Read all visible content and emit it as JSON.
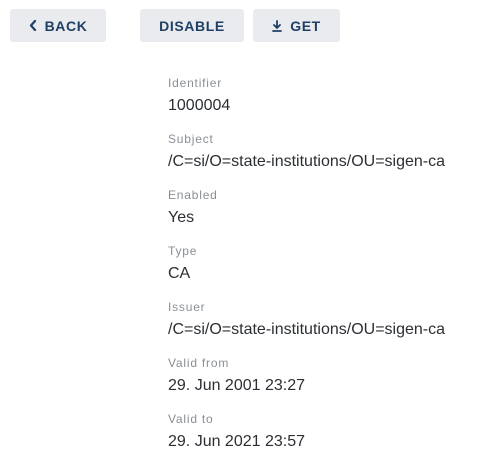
{
  "toolbar": {
    "back_label": "BACK",
    "back_icon": "chevron-left-icon",
    "disable_label": "DISABLE",
    "get_label": "GET",
    "get_icon": "download-icon"
  },
  "details": {
    "identifier": {
      "label": "Identifier",
      "value": "1000004"
    },
    "subject": {
      "label": "Subject",
      "value": "/C=si/O=state-institutions/OU=sigen-ca"
    },
    "enabled": {
      "label": "Enabled",
      "value": "Yes"
    },
    "type": {
      "label": "Type",
      "value": "CA"
    },
    "issuer": {
      "label": "Issuer",
      "value": "/C=si/O=state-institutions/OU=sigen-ca"
    },
    "valid_from": {
      "label": "Valid from",
      "value": "29. Jun 2001 23:27"
    },
    "valid_to": {
      "label": "Valid to",
      "value": "29. Jun 2021 23:57"
    }
  },
  "colors": {
    "button_bg": "#e9ebee",
    "button_text": "#1f3f66",
    "label_text": "#8a8f96",
    "value_text": "#2b2f33"
  }
}
